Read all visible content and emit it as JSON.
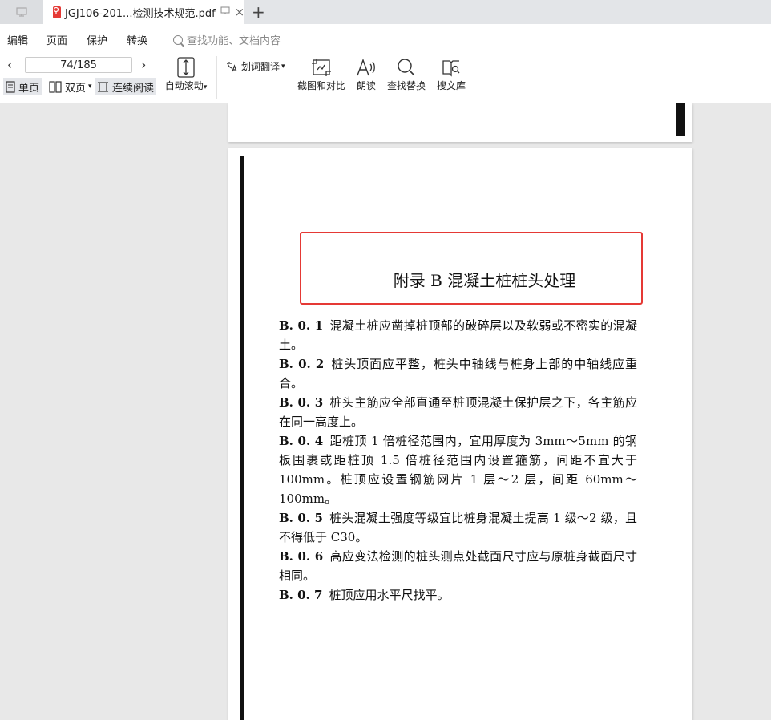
{
  "tab": {
    "title": "JGJ106-201...检测技术规范.pdf",
    "close_glyph": "×",
    "new_tab_glyph": "+"
  },
  "menu": {
    "items": [
      "编辑",
      "页面",
      "保护",
      "转换"
    ],
    "search_placeholder": "查找功能、文档内容"
  },
  "toolbar": {
    "page_indicator": "74/185",
    "views": [
      "单页",
      "双页",
      "连续阅读"
    ],
    "auto_scroll": "自动滚动",
    "translate": "划词翻译",
    "tools": [
      "截图和对比",
      "朗读",
      "查找替换",
      "搜文库"
    ]
  },
  "document": {
    "title": "附录 B   混凝土桩桩头处理",
    "clauses": [
      {
        "no": "B. 0. 1",
        "text": "混凝土桩应凿掉桩顶部的破碎层以及软弱或不密实的混凝土。"
      },
      {
        "no": "B. 0. 2",
        "text": "桩头顶面应平整，桩头中轴线与桩身上部的中轴线应重合。"
      },
      {
        "no": "B. 0. 3",
        "text": "桩头主筋应全部直通至桩顶混凝土保护层之下，各主筋应在同一高度上。"
      },
      {
        "no": "B. 0. 4",
        "text": "距桩顶 1 倍桩径范围内，宜用厚度为 3mm～5mm 的钢板围裹或距桩顶 1.5 倍桩径范围内设置箍筋，间距不宜大于 100mm。桩顶应设置钢筋网片 1 层～2 层，间距 60mm～100mm。"
      },
      {
        "no": "B. 0. 5",
        "text": "桩头混凝土强度等级宜比桩身混凝土提高 1 级～2 级，且不得低于 C30。"
      },
      {
        "no": "B. 0. 6",
        "text": "高应变法检测的桩头测点处截面尺寸应与原桩身截面尺寸相同。"
      },
      {
        "no": "B. 0. 7",
        "text": "桩顶应用水平尺找平。"
      }
    ]
  },
  "colors": {
    "highlight": "#e53935",
    "pdf_icon": "#e53935"
  }
}
